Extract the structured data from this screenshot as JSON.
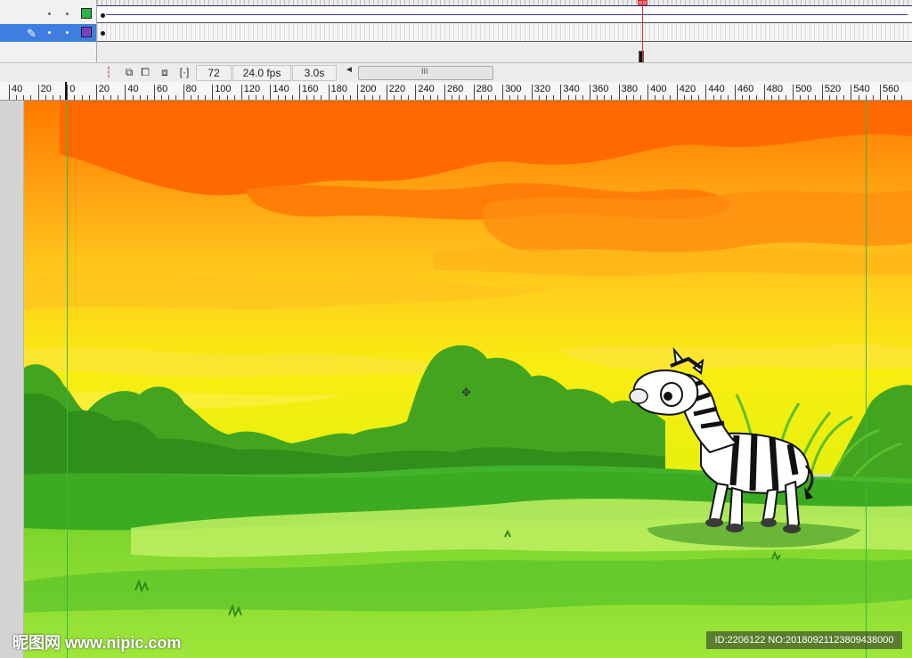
{
  "timeline": {
    "layers": [
      {
        "name": "",
        "outline_color": "#2bb34a"
      },
      {
        "name": "",
        "outline_color": "#7b3fc4",
        "selected": true
      }
    ],
    "current_frame": "72",
    "fps": "24.0 fps",
    "elapsed": "3.0s",
    "scroll_grip": "III",
    "scroll_left": "◄"
  },
  "ruler": {
    "labels": [
      "40",
      "20",
      "0",
      "20",
      "40",
      "60",
      "80",
      "100",
      "120",
      "140",
      "160",
      "180",
      "200",
      "220",
      "240",
      "260",
      "280",
      "300",
      "320",
      "340",
      "360",
      "380",
      "400",
      "420",
      "440",
      "460",
      "480",
      "500",
      "520",
      "540",
      "560"
    ]
  },
  "stage": {
    "scene": "savanna-sunset-with-zebra",
    "sky_colors": [
      "#ff6a00",
      "#ff9a10",
      "#ffd020",
      "#f6f210"
    ],
    "grass_colors": [
      "#3db02a",
      "#7ed62c",
      "#b8ec4a"
    ],
    "cursor_icon": "move-cursor-icon"
  },
  "watermarks": {
    "site": "昵图网 www.nipic.com",
    "id_text": "ID:2206122 NO:20180921123809438000"
  },
  "colors": {
    "selection_blue": "#3d7ee0",
    "playhead_red": "#e23030",
    "guide_green": "#39b54a"
  }
}
